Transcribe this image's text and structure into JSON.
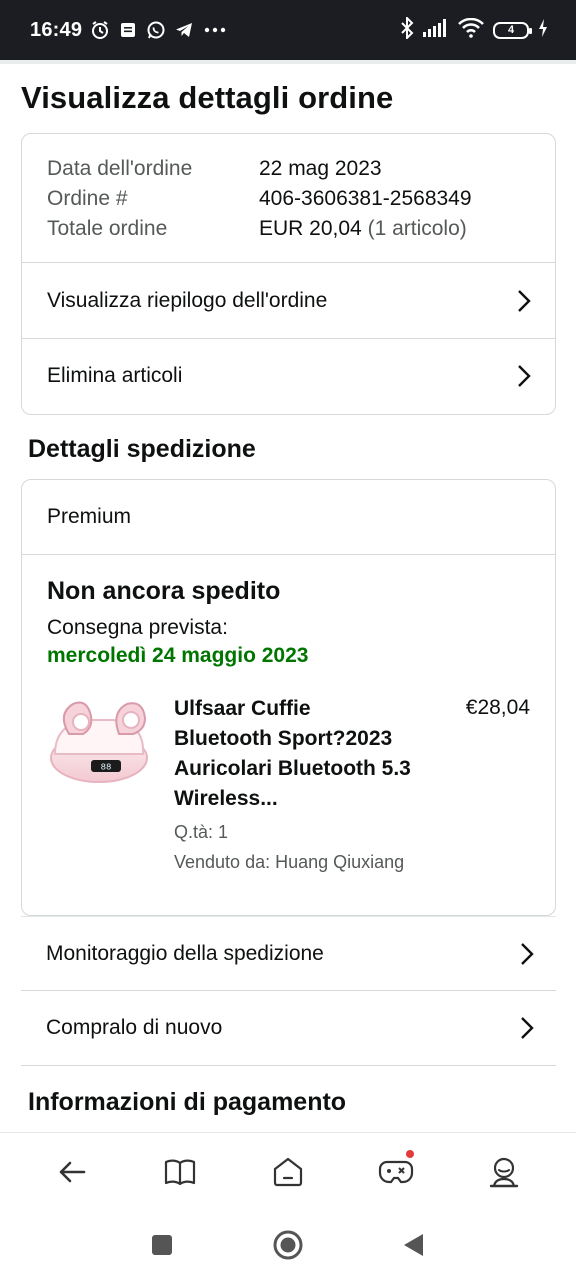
{
  "status_bar": {
    "time": "16:49",
    "battery_level": "4",
    "icons": [
      "alarm-icon",
      "message-icon",
      "whatsapp-icon",
      "telegram-icon",
      "more-icon",
      "bluetooth-icon",
      "signal-icon",
      "wifi-icon",
      "battery-icon",
      "charging-icon"
    ]
  },
  "page": {
    "title": "Visualizza dettagli ordine"
  },
  "order_summary": {
    "rows": [
      {
        "label": "Data dell'ordine",
        "value": "22 mag 2023",
        "extra": ""
      },
      {
        "label": "Ordine #",
        "value": "406-3606381-2568349",
        "extra": ""
      },
      {
        "label": "Totale ordine",
        "value": "EUR 20,04",
        "extra": "(1 articolo)"
      }
    ],
    "links": [
      {
        "label": "Visualizza riepilogo dell'ordine"
      },
      {
        "label": "Elimina articoli"
      }
    ]
  },
  "shipping": {
    "section_title": "Dettagli spedizione",
    "type": "Premium",
    "status": "Non ancora spedito",
    "eta_label": "Consegna prevista:",
    "eta_date": "mercoledì 24 maggio 2023",
    "item": {
      "title": "Ulfsaar Cuffie Bluetooth Sport?2023 Auricolari Bluetooth 5.3 Wireless...",
      "price": "€28,04",
      "qty": "Q.tà: 1",
      "seller": "Venduto da: Huang Qiuxiang",
      "image_display": "88"
    },
    "links": [
      {
        "label": "Monitoraggio della spedizione"
      },
      {
        "label": "Compralo di nuovo"
      }
    ]
  },
  "payment": {
    "section_title": "Informazioni di pagamento"
  },
  "bottom_nav": {
    "items": [
      "back-arrow-icon",
      "book-icon",
      "home-icon",
      "gamepad-icon",
      "account-icon"
    ]
  },
  "colors": {
    "accent_green": "#007600",
    "border": "#d5d9d9",
    "text_muted": "#565959",
    "status_bar_bg": "#1b1d22"
  }
}
